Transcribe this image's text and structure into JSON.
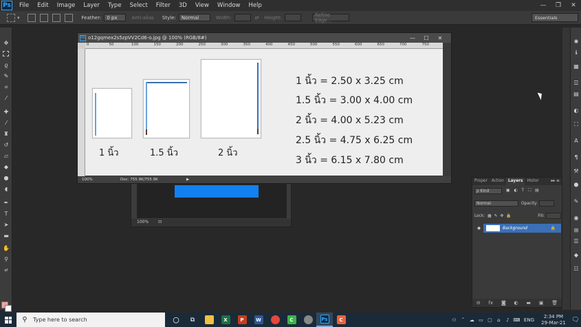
{
  "app": {
    "logo": "Ps",
    "menu": [
      "File",
      "Edit",
      "Image",
      "Layer",
      "Type",
      "Select",
      "Filter",
      "3D",
      "View",
      "Window",
      "Help"
    ],
    "window_controls": [
      "—",
      "❐",
      "✕"
    ]
  },
  "options": {
    "feather_label": "Feather:",
    "feather_value": "0 px",
    "antialias_label": "Anti-alias",
    "style_label": "Style:",
    "style_value": "Normal",
    "width_label": "Width:",
    "height_label": "Height:",
    "refine_label": "Refine Edge...",
    "workspace": "Essentials"
  },
  "document": {
    "title": "o12gqmex2s5zpVV2Cd6-o.jpg @ 100% (RGB/8#)",
    "zoom": "100%",
    "doc_size": "Doc: 755.9K/755.9K",
    "ruler_ticks": [
      "0",
      "50",
      "100",
      "150",
      "200",
      "250",
      "300",
      "350",
      "400",
      "450",
      "500",
      "550",
      "600",
      "650",
      "700",
      "750"
    ],
    "papers": [
      {
        "label": "1 นิ้ว"
      },
      {
        "label": "1.5 นิ้ว"
      },
      {
        "label": "2 นิ้ว"
      }
    ],
    "specs": [
      "1 นิ้ว    =  2.50 x 3.25 cm",
      "1.5 นิ้ว = 3.00 x 4.00 cm",
      "2 นิ้ว    = 4.00 x 5.23 cm",
      "2.5 นิ้ว = 4.75 x 6.25 cm",
      "3 นิ้ว    = 6.15 x 7.80 cm"
    ]
  },
  "background_document": {
    "zoom": "100%"
  },
  "layers_panel": {
    "tabs": [
      "Proper",
      "Action",
      "Layers",
      "Histor"
    ],
    "active_tab": "Layers",
    "kind_label": "ρ Kind",
    "blend_mode": "Normal",
    "opacity_label": "Opacity:",
    "lock_label": "Lock:",
    "fill_label": "Fill:",
    "layer_name": "Background"
  },
  "taskbar": {
    "search_placeholder": "Type here to search",
    "lang": "ENG",
    "time": "2:34 PM",
    "date": "29-Mar-21"
  },
  "colors": {
    "foreground": "#f3a3a3",
    "background": "#ffffff",
    "accent_blue": "#1380f0",
    "layer_selected": "#3b6fb6"
  }
}
